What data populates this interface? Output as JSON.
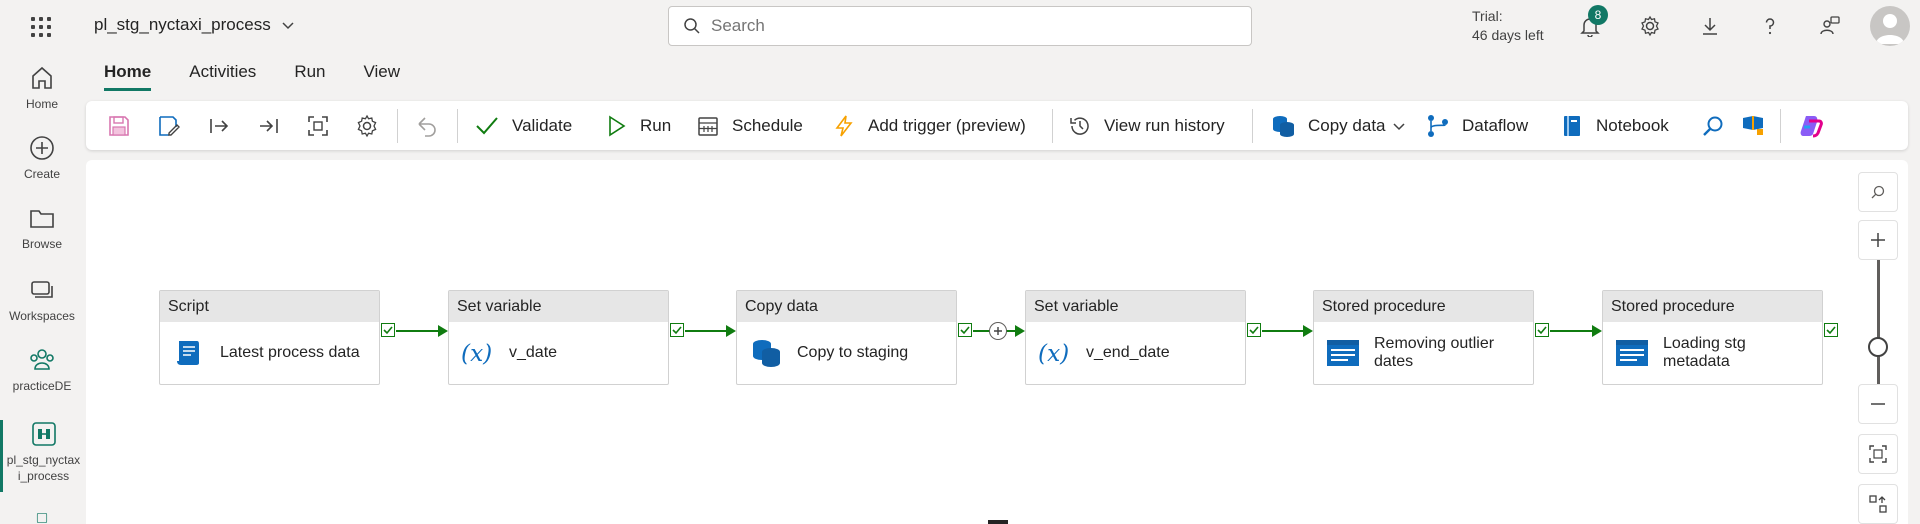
{
  "header": {
    "item_title": "pl_stg_nyctaxi_process",
    "search_placeholder": "Search",
    "trial_line1": "Trial:",
    "trial_line2": "46 days left",
    "notification_count": "8"
  },
  "rail": {
    "items": [
      {
        "label": "Home",
        "icon": "home-icon"
      },
      {
        "label": "Create",
        "icon": "plus-circle-icon"
      },
      {
        "label": "Browse",
        "icon": "folder-icon"
      },
      {
        "label": "Workspaces",
        "icon": "workspaces-icon"
      },
      {
        "label": "practiceDE",
        "icon": "workspace-people-icon"
      },
      {
        "label": "pl_stg_nyctaxi_process",
        "icon": "pipeline-icon"
      }
    ]
  },
  "ribbon": {
    "tabs": [
      "Home",
      "Activities",
      "Run",
      "View"
    ],
    "active_tab": "Home"
  },
  "toolbar": {
    "validate": "Validate",
    "run": "Run",
    "schedule": "Schedule",
    "add_trigger": "Add trigger (preview)",
    "view_run_history": "View run history",
    "copy_data": "Copy data",
    "dataflow": "Dataflow",
    "notebook": "Notebook"
  },
  "pipeline": {
    "activities": [
      {
        "type": "Script",
        "name": "Latest process data",
        "icon": "script-icon"
      },
      {
        "type": "Set variable",
        "name": "v_date",
        "icon": "variable-icon"
      },
      {
        "type": "Copy data",
        "name": "Copy to staging",
        "icon": "copy-data-icon"
      },
      {
        "type": "Set variable",
        "name": "v_end_date",
        "icon": "variable-icon"
      },
      {
        "type": "Stored procedure",
        "name": "Removing outlier dates",
        "icon": "stored-procedure-icon"
      },
      {
        "type": "Stored procedure",
        "name": "Loading stg metadata",
        "icon": "stored-procedure-icon"
      }
    ]
  },
  "colors": {
    "accent": "#117865",
    "success": "#107c10",
    "copilot": "#8a5cf6"
  }
}
